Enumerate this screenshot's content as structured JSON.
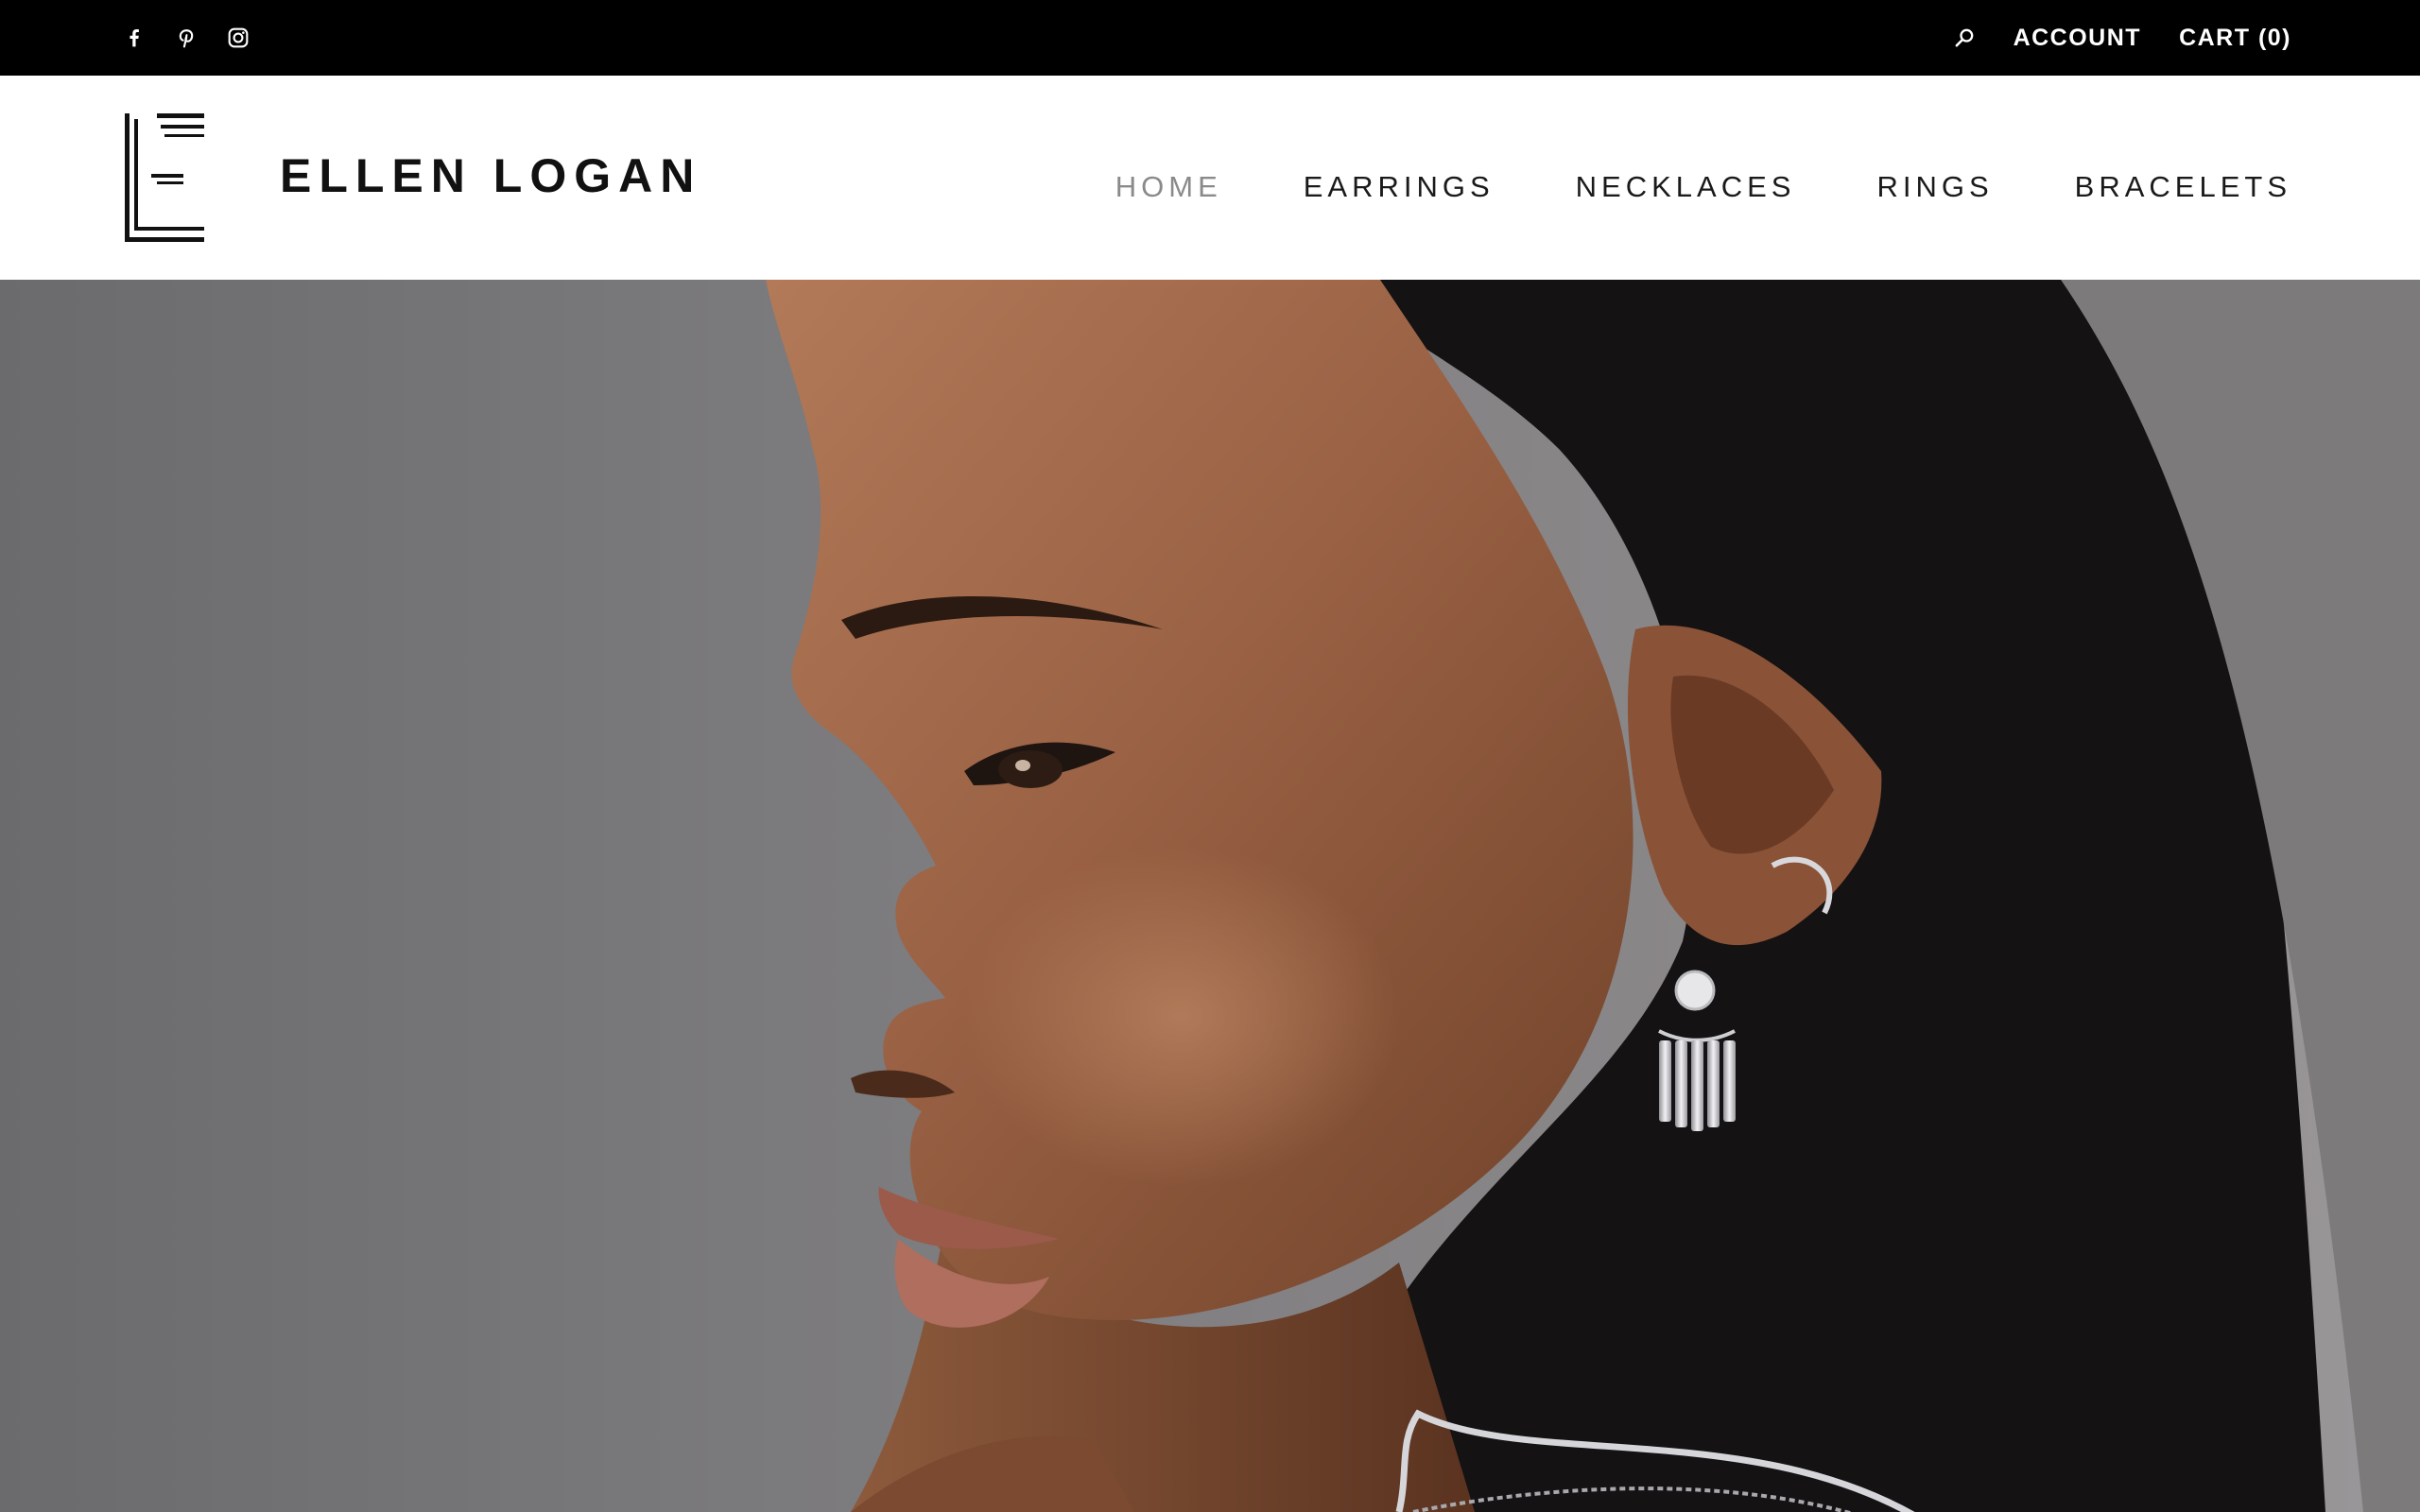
{
  "topbar": {
    "social_icons": [
      "facebook-icon",
      "pinterest-icon",
      "instagram-icon"
    ],
    "search_icon": "search-icon",
    "account_label": "ACCOUNT",
    "cart_label": "CART (0)"
  },
  "header": {
    "brand_name": "ELLEN LOGAN",
    "nav": [
      {
        "label": "HOME",
        "active": true
      },
      {
        "label": "EARRINGS",
        "active": false
      },
      {
        "label": "NECKLACES",
        "active": false
      },
      {
        "label": "RINGS",
        "active": false
      },
      {
        "label": "BRACELETS",
        "active": false
      }
    ]
  },
  "hero": {
    "image": "portrait-model-wearing-earrings"
  },
  "colors": {
    "topbar_bg": "#000000",
    "text_dark": "#111111",
    "nav_active": "#8a8a8a",
    "background": "#ffffff"
  }
}
